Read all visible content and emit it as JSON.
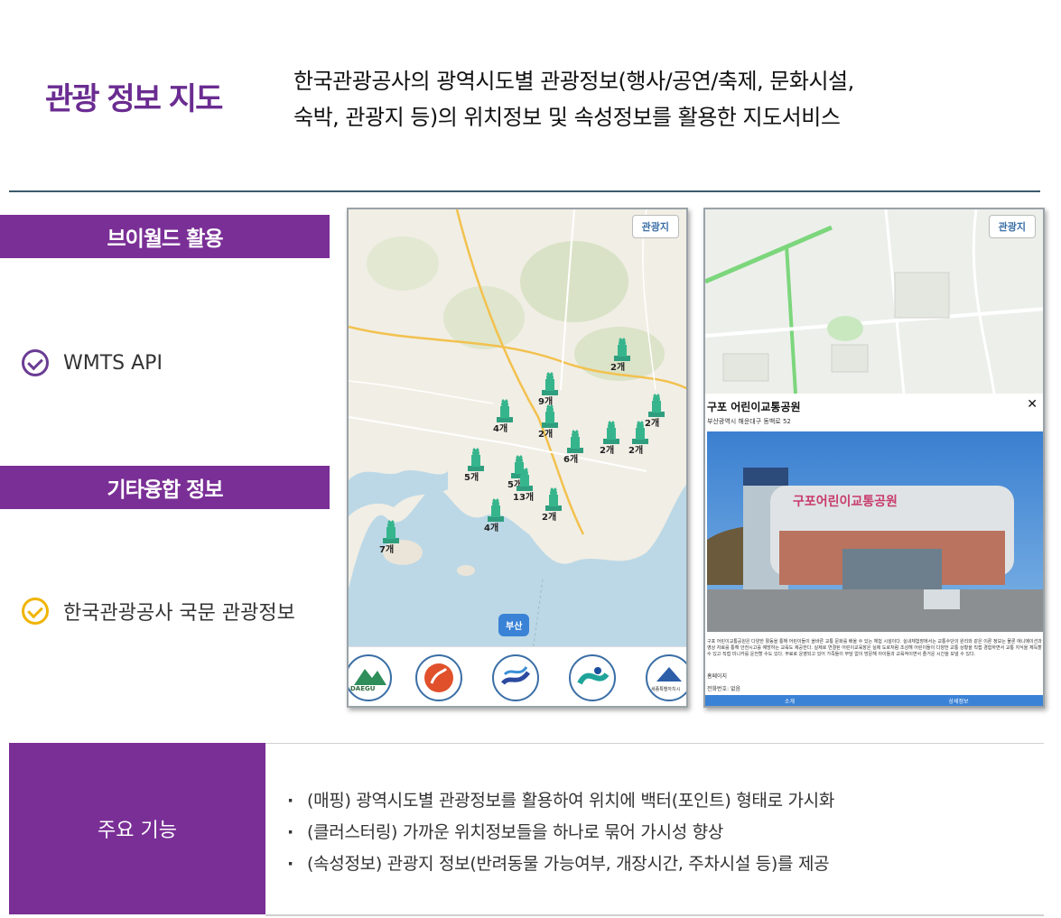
{
  "header": {
    "title": "관광 정보 지도",
    "description_line1": "한국관광공사의  광역시도별  관광정보(행사/공연/축제,  문화시설,",
    "description_line2": "숙박, 관광지 등)의 위치정보 및 속성정보를 활용한 지도서비스"
  },
  "sections": [
    {
      "title": "브이월드 활용",
      "feature": "WMTS API",
      "check_color": "#6a3c94"
    },
    {
      "title": "기타융합 정보",
      "feature": "한국관광공사 국문 관광정보",
      "check_color": "#f0b400"
    }
  ],
  "map_left": {
    "button": "관광지",
    "region_pill": "부산",
    "clusters": [
      "2개",
      "9개",
      "4개",
      "2개",
      "2개",
      "6개",
      "2개",
      "2개",
      "5개",
      "5개",
      "13개",
      "2개",
      "4개",
      "7개"
    ],
    "logos": [
      "DAEGU",
      "",
      "",
      "",
      "세종특별자치시"
    ]
  },
  "map_right": {
    "button": "관광지",
    "popup": {
      "title": "구포 어린이교통공원",
      "address": "부산광역시 해운대구 동백로 52",
      "photo_sign": "구포어린이교통공원",
      "description": "구포 어린이교통공원은 다양한 활동을 통해 어린이들이 올바른 교통 문화를 배울 수 있는 체험 시설이다. 실내체험장에서는 교통수단의 원리와 같은 이론 정보는 물론 애니메이션과 영상 자료를 통해 안전시고를 예방하는 교육도 제공한다. 실제로 연결된 어린이교육장은 실제 도로처럼 조성해 어린이들이 다양한 교통 상황을 직접 경험하면서 교통 지식을 체득할 수 있고 직접 미니카를 운전할 수도 있다. 무료로 운영되고 있어 가족들이 부담 없이 방문해 아이들과 교육적이면서 즐거운 시간을 보낼 수 있다.",
      "homepage_label": "홈페이지",
      "phone_label": "전화번호: 없음",
      "tab1": "소개",
      "tab2": "상세정보"
    }
  },
  "table": {
    "head": "주요 기능",
    "items": [
      "(매핑) 광역시도별 관광정보를 활용하여 위치에 백터(포인트) 형태로 가시화",
      "(클러스터링) 가까운 위치정보들을 하나로 묶어 가시성 향상",
      "(속성정보) 관광지 정보(반려동물 가능여부, 개장시간, 주차시설 등)를 제공"
    ]
  }
}
